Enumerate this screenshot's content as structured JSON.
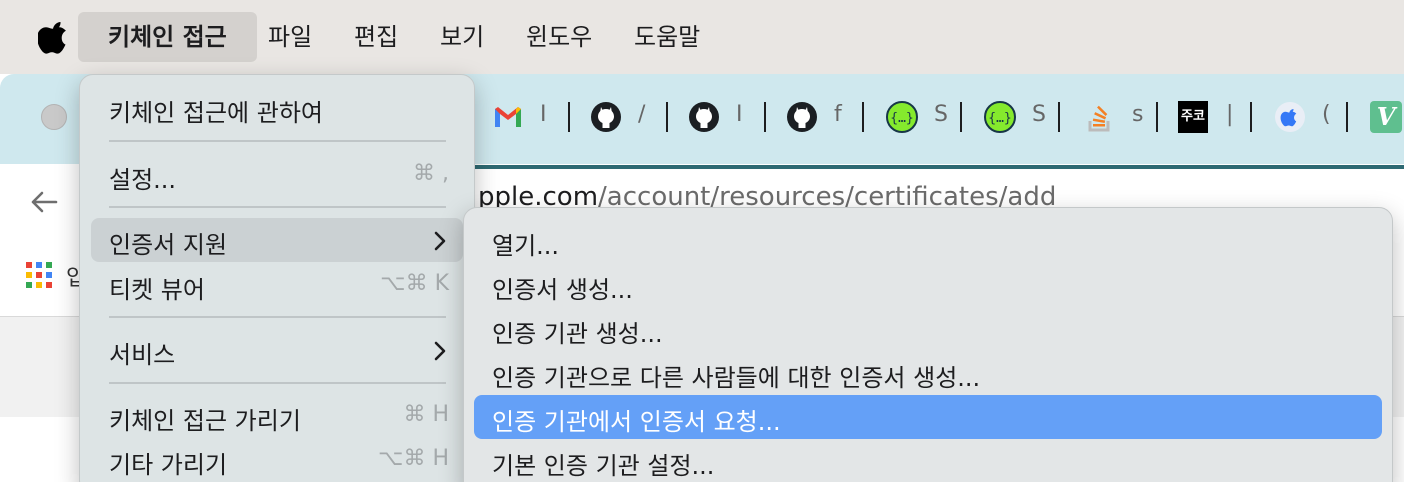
{
  "menubar": {
    "apple_icon": "apple-logo",
    "items": [
      "키체인 접근",
      "파일",
      "편집",
      "보기",
      "윈도우",
      "도움말"
    ]
  },
  "browser": {
    "url_host": "pple.com",
    "url_path": "/account/resources/certificates/add",
    "bookmark_label": "입",
    "tabs": [
      {
        "icon": "gmail-icon",
        "label": "I"
      },
      {
        "icon": "github-icon",
        "label": "/"
      },
      {
        "icon": "github-icon",
        "label": "I"
      },
      {
        "icon": "github-icon",
        "label": "f"
      },
      {
        "icon": "swagger-icon",
        "label": "S"
      },
      {
        "icon": "swagger-icon",
        "label": "S"
      },
      {
        "icon": "stackoverflow-icon",
        "label": "s"
      },
      {
        "icon": "jucode-icon",
        "label": "|"
      },
      {
        "icon": "apple-dev-icon",
        "label": "("
      },
      {
        "icon": "vuetify-icon",
        "label": ""
      }
    ],
    "jucode_text": "주코",
    "vuetify_text": "V"
  },
  "menu": {
    "about": "키체인 접근에 관하여",
    "settings": "설정...",
    "settings_shortcut": "⌘ ,",
    "cert_assistant": "인증서 지원",
    "ticket_viewer": "티켓 뷰어",
    "ticket_viewer_shortcut": "⌥⌘ K",
    "services": "서비스",
    "hide": "키체인 접근 가리기",
    "hide_shortcut": "⌘ H",
    "hide_others": "기타 가리기",
    "hide_others_shortcut": "⌥⌘ H"
  },
  "submenu": {
    "items": [
      "열기...",
      "인증서 생성...",
      "인증 기관 생성...",
      "인증 기관으로 다른 사람들에 대한 인증서 생성...",
      "인증 기관에서 인증서 요청...",
      "기본 인증 기관 설정..."
    ],
    "selected_index": 4
  },
  "colors": {
    "menubar_bg": "#e9e6e3",
    "menu_bg": "#dde4e5",
    "submenu_bg": "#e3e6e7",
    "selection": "#64a0f7",
    "browser_tabbar": "#cfe8ee"
  }
}
